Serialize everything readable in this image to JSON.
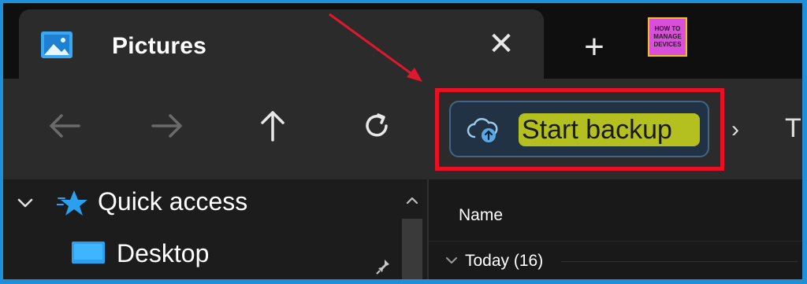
{
  "tab": {
    "title": "Pictures",
    "close_glyph": "✕",
    "icon": "pictures-folder-icon"
  },
  "new_tab": {
    "glyph": "+"
  },
  "watermark_logo": {
    "lines": [
      "HOW TO",
      "MANAGE",
      "DEVICES"
    ]
  },
  "toolbar": {
    "back_icon": "arrow-left-icon",
    "forward_icon": "arrow-right-icon",
    "up_icon": "arrow-up-icon",
    "refresh_icon": "refresh-icon",
    "backup_button_label": "Start backup",
    "backup_icon": "cloud-upload-icon",
    "breadcrumb_chevron": "›",
    "breadcrumb_next_partial": "Th"
  },
  "navigation_pane": {
    "items": [
      {
        "label": "Quick access",
        "icon": "star-icon",
        "expanded": true
      },
      {
        "label": "Desktop",
        "icon": "desktop-icon",
        "pinned": true
      }
    ]
  },
  "content_pane": {
    "column_header": "Name",
    "group_label": "Today (16)"
  },
  "colors": {
    "highlight_border": "#e81123",
    "text_highlight": "#cfd91a",
    "annotation_arrow": "#e0182d",
    "accent_blue": "#2aa0f0"
  }
}
